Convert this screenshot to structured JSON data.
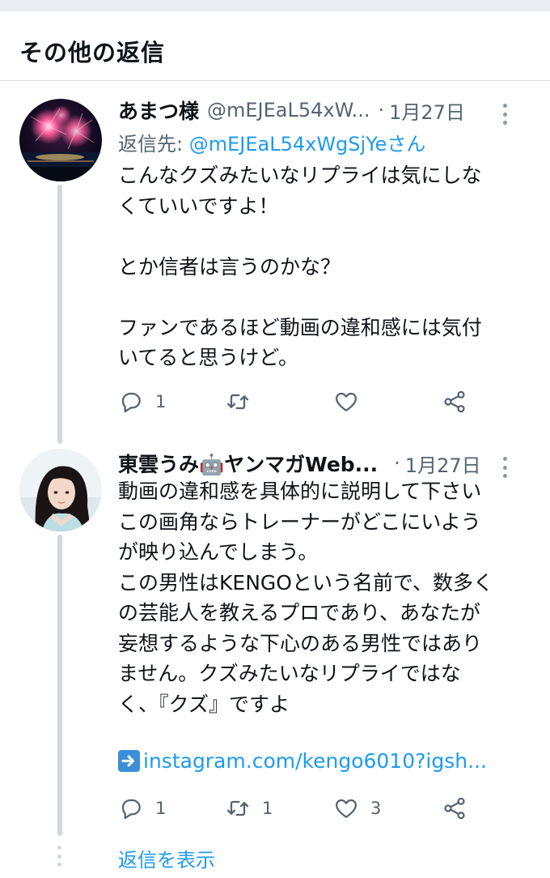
{
  "section": {
    "title": "その他の返信"
  },
  "tweets": [
    {
      "display_name": "あまつ様",
      "handle": "@mEJEaL54xW...",
      "dot": "·",
      "date": "1月27日",
      "reply_to_prefix": "返信先: ",
      "reply_to_mention": "@mEJEaL54xWgSjYeさん",
      "text": "こんなクズみたいなリプライは気にしな\nくていいですよ！\n\nとか信者は言うのかな？\n\nファンであるほど動画の違和感には気付\nいてると思うけど。",
      "avatar_icon": "fireworks-avatar",
      "reply_count": "1",
      "retweet_count": "",
      "like_count": ""
    },
    {
      "display_name": "東雲うみ🤖ヤンマガWeb...",
      "handle": "",
      "dot": "·",
      "date": "1月27日",
      "text": "動画の違和感を具体的に説明して下さい\nこの画角ならトレーナーがどこにいよう\nが映り込んでしまう。\nこの男性はKENGOという名前で、数多く\nの芸能人を教えるプロであり、あなたが\n妄想するような下心のある男性ではあり\nません。クズみたいなリプライではな\nく、『クズ』ですよ",
      "link_text": "instagram.com/kengo6010?igsh...",
      "link_icon": "right-arrow-emoji-icon",
      "avatar_icon": "portrait-avatar",
      "reply_count": "1",
      "retweet_count": "1",
      "like_count": "3"
    }
  ],
  "footer": {
    "show_replies": "返信を表示"
  },
  "colors": {
    "link_blue": "#1d9bf0",
    "muted_gray": "#536471",
    "thread_line": "#cfd9de",
    "text": "#0f1419"
  }
}
